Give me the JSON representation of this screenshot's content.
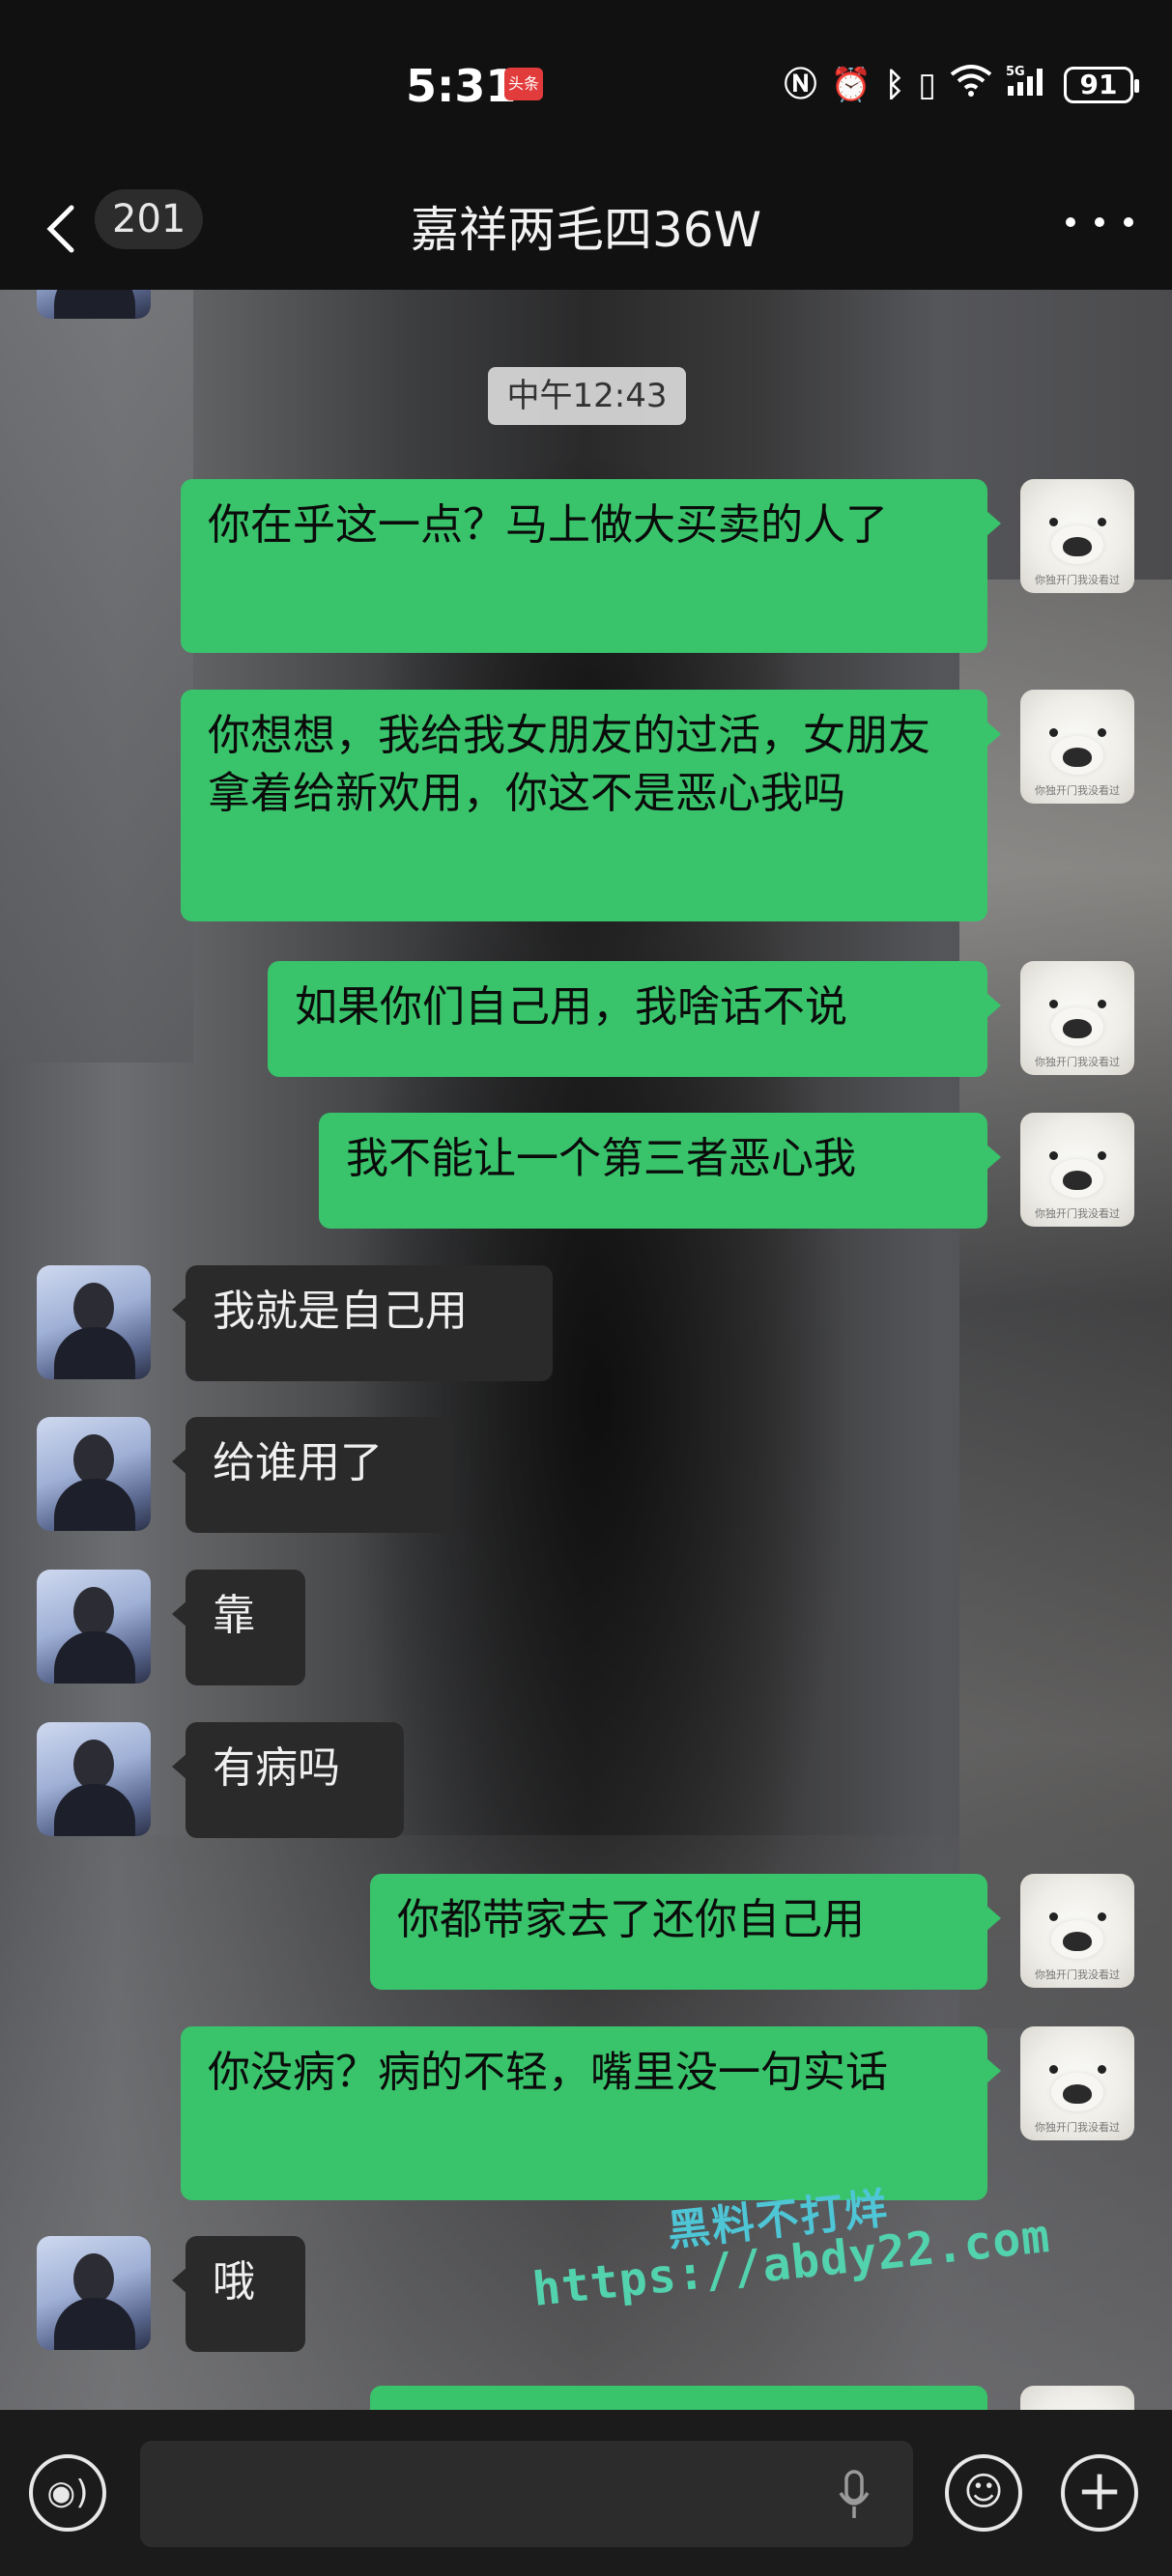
{
  "status_bar": {
    "time": "5:31",
    "badge": "头条",
    "battery": "91",
    "icons": [
      "nfc-icon",
      "alarm-icon",
      "bluetooth-icon",
      "vibrate-icon",
      "wifi-icon",
      "5g-signal-icon"
    ]
  },
  "header": {
    "back_count": "201",
    "title": "嘉祥两毛四36W"
  },
  "chat": {
    "timestamp": "中午12:43",
    "messages": [
      {
        "side": "out",
        "text": "你在乎这一点？马上做大买卖的人了"
      },
      {
        "side": "out",
        "text": "你想想，我给我女朋友的过活，女朋友拿着给新欢用，你这不是恶心我吗"
      },
      {
        "side": "out",
        "text": "如果你们自己用，我啥话不说"
      },
      {
        "side": "out",
        "text": "我不能让一个第三者恶心我"
      },
      {
        "side": "in",
        "text": "我就是自己用"
      },
      {
        "side": "in",
        "text": "给谁用了"
      },
      {
        "side": "in",
        "text": "靠"
      },
      {
        "side": "in",
        "text": "有病吗"
      },
      {
        "side": "out",
        "text": "你都带家去了还你自己用"
      },
      {
        "side": "out",
        "text": "你没病？病的不轻，嘴里没一句实话"
      },
      {
        "side": "in",
        "text": "哦"
      }
    ],
    "avatar_caption": "你独开门我没看过"
  },
  "watermark": {
    "line1": "黑料不打烊",
    "line2": "https://abdy22.com"
  },
  "colors": {
    "outgoing_bubble": "#39c46b",
    "incoming_bubble": "#2a2a2a",
    "top_bar": "#111111"
  }
}
